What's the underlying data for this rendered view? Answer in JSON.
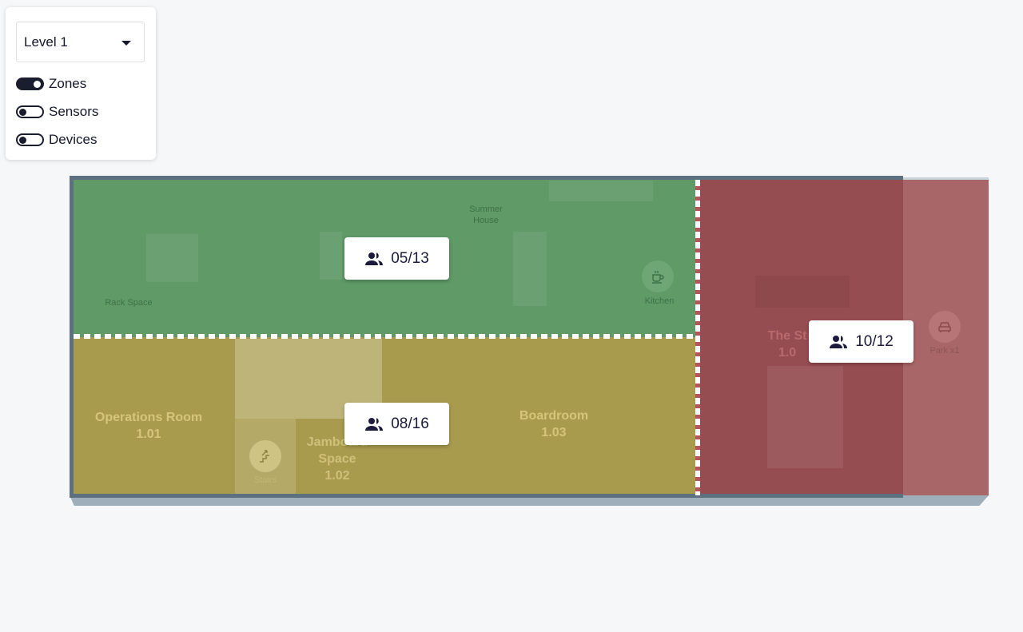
{
  "controls": {
    "level_select": {
      "value": "Level 1"
    },
    "toggles": [
      {
        "label": "Zones",
        "on": true
      },
      {
        "label": "Sensors",
        "on": false
      },
      {
        "label": "Devices",
        "on": false
      }
    ]
  },
  "map": {
    "zones": [
      {
        "occupancy": "05/13",
        "color": "#5f9a67",
        "status": "green"
      },
      {
        "occupancy": "08/16",
        "color": "#a99b4d",
        "status": "yellow"
      },
      {
        "occupancy": "10/12",
        "color": "#954d51",
        "status": "red"
      }
    ],
    "rooms": [
      {
        "name": "Operations Room",
        "number": "1.01"
      },
      {
        "name": "Jamboard Space",
        "number": "1.02"
      },
      {
        "name": "Boardroom",
        "number": "1.03"
      },
      {
        "name": "The St",
        "number": "1.0"
      }
    ],
    "labels": {
      "rack_space": "Rack Space",
      "summer_house": "Summer House",
      "kitchen": "Kitchen",
      "stairs": "Stairs",
      "park": "Park x1"
    },
    "icons": {
      "occupancy": "people-icon",
      "kitchen": "coffee-cup-icon",
      "stairs": "stairs-icon",
      "park": "car-icon"
    }
  }
}
